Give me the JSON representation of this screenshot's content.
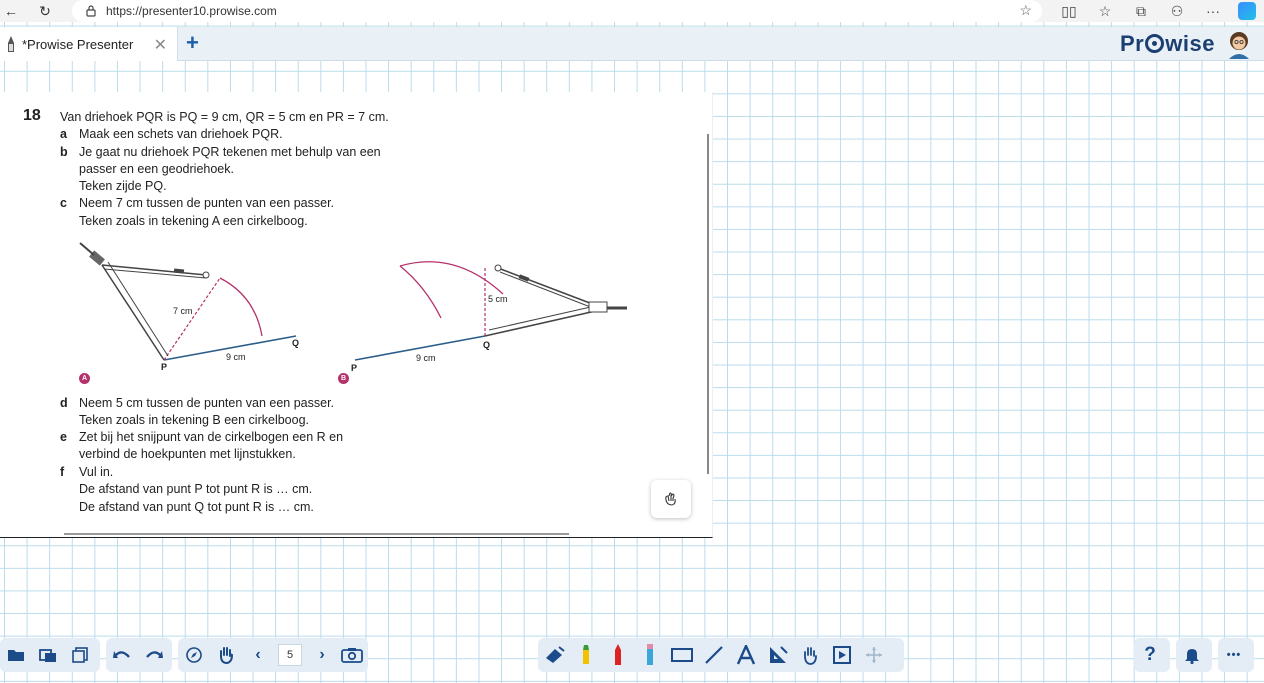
{
  "browser": {
    "url": "https://presenter10.prowise.com"
  },
  "app": {
    "tab_title": "*Prowise Presenter",
    "logo_text_left": "Pr",
    "logo_text_right": "wise"
  },
  "exercise": {
    "number": "18",
    "lines": [
      "Van driehoek PQR is PQ = 9 cm, QR = 5 cm en PR = 7 cm.",
      "Maak een schets van driehoek PQR.",
      "Je gaat nu driehoek PQR tekenen met behulp van een",
      "passer en een geodriehoek.",
      "Teken zijde PQ.",
      "Neem 7 cm tussen de punten van een passer.",
      "Teken zoals in tekening A een cirkelboog.",
      "Neem 5 cm tussen de punten van een passer.",
      "Teken zoals in tekening B een cirkelboog.",
      "Zet bij het snijpunt van de cirkelbogen een R en",
      "verbind de hoekpunten met lijnstukken.",
      "Vul in.",
      "De afstand van punt P tot punt R is … cm.",
      "De afstand van punt Q tot punt R is … cm."
    ],
    "letters": [
      "a",
      "b",
      "c",
      "d",
      "e",
      "f"
    ],
    "figure_a": {
      "badge": "A",
      "label_radius": "7 cm",
      "label_base": "9 cm",
      "point_p": "P",
      "point_q": "Q"
    },
    "figure_b": {
      "badge": "B",
      "label_radius": "5 cm",
      "label_base": "9 cm",
      "point_p": "P",
      "point_q": "Q"
    }
  },
  "toolbar": {
    "page_number": "5",
    "help_label": "?",
    "more_label": "•••"
  },
  "colors": {
    "arc": "#b5316b",
    "base_line": "#2a5d8a",
    "accent": "#1c4b8a"
  }
}
